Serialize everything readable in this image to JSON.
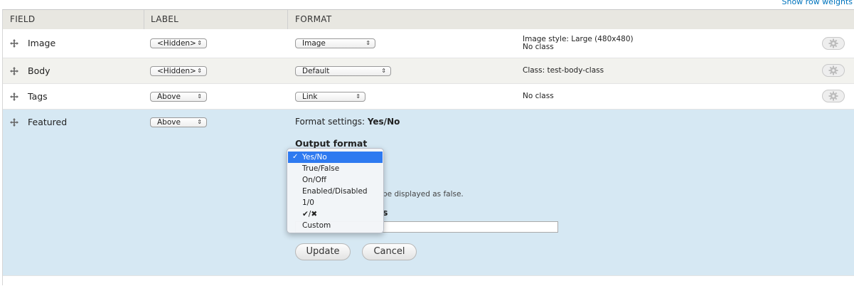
{
  "top": {
    "show_row_weights": "Show row weights"
  },
  "header": {
    "field": "FIELD",
    "label": "LABEL",
    "format": "FORMAT"
  },
  "rows": [
    {
      "name": "Image",
      "label_select": "<Hidden>",
      "format_select": "Image",
      "summary_line1": "Image style: Large (480x480)",
      "summary_line2": "No class"
    },
    {
      "name": "Body",
      "label_select": "<Hidden>",
      "format_select": "Default",
      "summary_line1": "Class: test-body-class",
      "summary_line2": ""
    },
    {
      "name": "Tags",
      "label_select": "Above",
      "format_select": "Link",
      "summary_line1": "No class",
      "summary_line2": ""
    }
  ],
  "featured": {
    "name": "Featured",
    "label_select": "Above",
    "settings_prefix": "Format settings: ",
    "settings_value": "Yes/No",
    "output_format_label": "Output format",
    "description_fragment": "be displayed as false.",
    "custom_label_fragment": "s",
    "update_label": "Update",
    "cancel_label": "Cancel"
  },
  "dropdown": {
    "options": [
      "Yes/No",
      "True/False",
      "On/Off",
      "Enabled/Disabled",
      "1/0",
      "✔/✖",
      "Custom"
    ],
    "selected": "Yes/No",
    "check": "✓"
  },
  "colors": {
    "link": "#0074bd",
    "featured_bg": "#d6e8f3",
    "menu_highlight": "#2e7af0",
    "header_bg": "#e8e7e1"
  },
  "icons": {
    "drag": "drag-handle-icon",
    "gear": "gear-icon",
    "select_arrows": "updown-arrows-icon"
  }
}
